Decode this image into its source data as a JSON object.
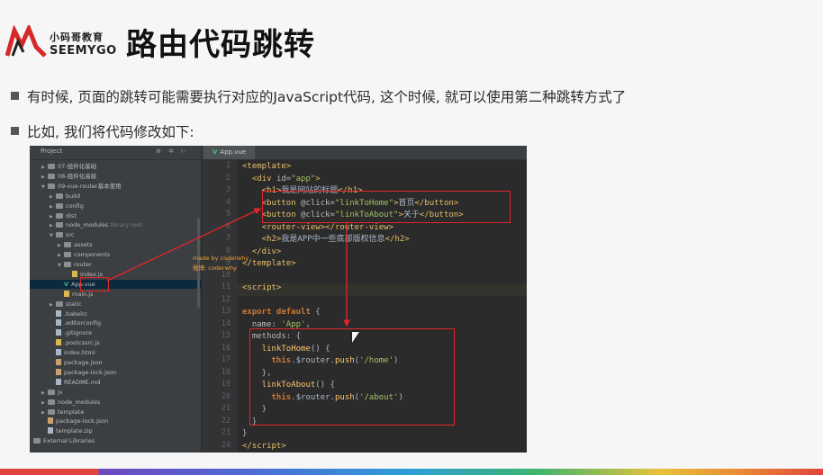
{
  "logo": {
    "brand_cn": "小码哥教育",
    "brand_en": "SEEMYGO"
  },
  "slide": {
    "title": "路由代码跳转",
    "bullet1": "有时候, 页面的跳转可能需要执行对应的JavaScript代码, 这个时候, 就可以使用第二种跳转方式了",
    "bullet2": "比如, 我们将代码修改如下:"
  },
  "ide": {
    "panel_title": "Project",
    "tab_label": "App.vue",
    "annotation_line1": "made by coderwhy",
    "annotation_line2": "微博: coderwhy",
    "tree": [
      {
        "label": "07-组件化基础",
        "kind": "folder",
        "depth": 0,
        "open": false
      },
      {
        "label": "08-组件化高级",
        "kind": "folder",
        "depth": 0,
        "open": false
      },
      {
        "label": "09-vue-router基本使用",
        "kind": "folder",
        "depth": 0,
        "open": true
      },
      {
        "label": "build",
        "kind": "folder",
        "depth": 1,
        "open": false
      },
      {
        "label": "config",
        "kind": "folder",
        "depth": 1,
        "open": false
      },
      {
        "label": "dist",
        "kind": "folder",
        "depth": 1,
        "open": false
      },
      {
        "label": "node_modules",
        "kind": "folder",
        "depth": 1,
        "open": false,
        "note": "library root"
      },
      {
        "label": "src",
        "kind": "folder",
        "depth": 1,
        "open": true
      },
      {
        "label": "assets",
        "kind": "folder",
        "depth": 2,
        "open": false
      },
      {
        "label": "components",
        "kind": "folder",
        "depth": 2,
        "open": false
      },
      {
        "label": "router",
        "kind": "folder",
        "depth": 2,
        "open": true
      },
      {
        "label": "index.js",
        "kind": "js",
        "depth": 3
      },
      {
        "label": "App.vue",
        "kind": "vue",
        "depth": 2,
        "selected": true
      },
      {
        "label": "main.js",
        "kind": "js",
        "depth": 2
      },
      {
        "label": "static",
        "kind": "folder",
        "depth": 1,
        "open": false
      },
      {
        "label": ".babelrc",
        "kind": "file",
        "depth": 1
      },
      {
        "label": ".editorconfig",
        "kind": "file",
        "depth": 1
      },
      {
        "label": ".gitignore",
        "kind": "file",
        "depth": 1
      },
      {
        "label": ".postcssrc.js",
        "kind": "js",
        "depth": 1
      },
      {
        "label": "index.html",
        "kind": "file",
        "depth": 1
      },
      {
        "label": "package.json",
        "kind": "json",
        "depth": 1
      },
      {
        "label": "package-lock.json",
        "kind": "json",
        "depth": 1
      },
      {
        "label": "README.md",
        "kind": "file",
        "depth": 1
      },
      {
        "label": "js",
        "kind": "folder",
        "depth": 0,
        "open": false
      },
      {
        "label": "node_modules",
        "kind": "folder",
        "depth": 0,
        "open": false
      },
      {
        "label": "template",
        "kind": "folder",
        "depth": 0,
        "open": false
      },
      {
        "label": "package-lock.json",
        "kind": "json",
        "depth": 0
      },
      {
        "label": "template.zip",
        "kind": "file",
        "depth": 0
      },
      {
        "label": "External Libraries",
        "kind": "lib",
        "depth": -1
      }
    ],
    "code_lines": [
      {
        "n": "1",
        "html": "<span class='tg'>&lt;template&gt;</span>"
      },
      {
        "n": "2",
        "html": "  <span class='tg'>&lt;div </span><span class='at'>id=</span><span class='sv'>\"app\"</span><span class='tg'>&gt;</span>"
      },
      {
        "n": "3",
        "html": "    <span class='tg'>&lt;h1&gt;</span><span class='pl'>我是网站的标题</span><span class='tg'>&lt;/h1&gt;</span>"
      },
      {
        "n": "4",
        "html": "    <span class='tg'>&lt;button </span><span class='at'>@click=</span><span class='sv'>\"linkToHome\"</span><span class='tg'>&gt;</span><span class='pl'>首页</span><span class='tg'>&lt;/button&gt;</span>"
      },
      {
        "n": "5",
        "html": "    <span class='tg'>&lt;button </span><span class='at'>@click=</span><span class='sv'>\"linkToAbout\"</span><span class='tg'>&gt;</span><span class='pl'>关于</span><span class='tg'>&lt;/button&gt;</span>"
      },
      {
        "n": "6",
        "html": "    <span class='tg'>&lt;router-view&gt;&lt;/router-view&gt;</span>"
      },
      {
        "n": "7",
        "html": "    <span class='tg'>&lt;h2&gt;</span><span class='pl'>我是APP中一些底部版权信息</span><span class='tg'>&lt;/h2&gt;</span>"
      },
      {
        "n": "8",
        "html": "  <span class='tg'>&lt;/div&gt;</span>"
      },
      {
        "n": "9",
        "html": "<span class='tg'>&lt;/template&gt;</span>"
      },
      {
        "n": "10",
        "html": ""
      },
      {
        "n": "11",
        "html": "<span class='tg'>&lt;script&gt;</span>"
      },
      {
        "n": "12",
        "html": ""
      },
      {
        "n": "13",
        "html": "<span class='kw'>export default</span> {"
      },
      {
        "n": "14",
        "html": "  <span class='at'>name</span>: <span class='sv'>'App'</span>,"
      },
      {
        "n": "15",
        "html": "  <span class='at'>methods</span>: {"
      },
      {
        "n": "16",
        "html": "    <span class='fn'>linkToHome</span>() {"
      },
      {
        "n": "17",
        "html": "      <span class='kw'>this</span>.$router.<span class='fn'>push</span>(<span class='sv'>'/home'</span>)"
      },
      {
        "n": "18",
        "html": "    },"
      },
      {
        "n": "19",
        "html": "    <span class='fn'>linkToAbout</span>() {"
      },
      {
        "n": "20",
        "html": "      <span class='kw'>this</span>.$router.<span class='fn'>push</span>(<span class='sv'>'/about'</span>)"
      },
      {
        "n": "21",
        "html": "    }"
      },
      {
        "n": "22",
        "html": "  }"
      },
      {
        "n": "23",
        "html": "}"
      },
      {
        "n": "24",
        "html": "<span class='tg'>&lt;/script&gt;</span>"
      }
    ]
  }
}
